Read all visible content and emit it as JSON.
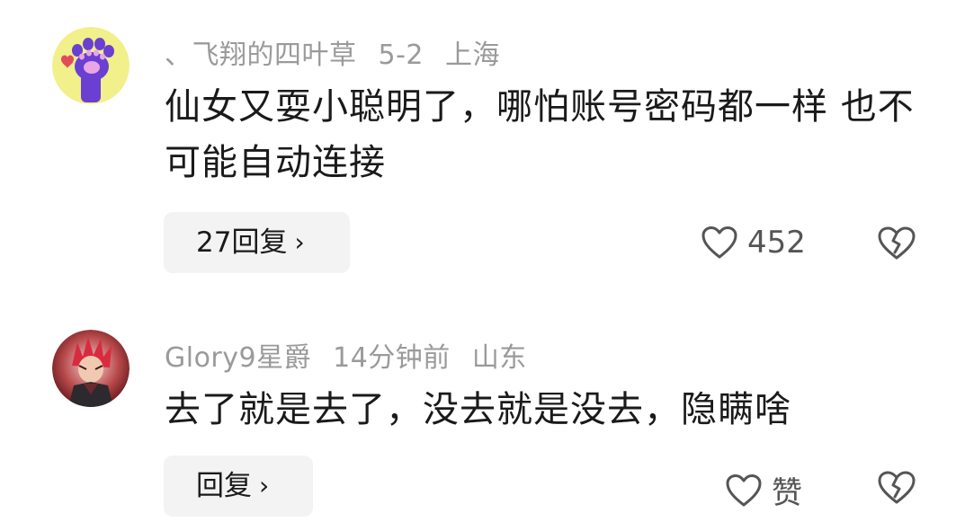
{
  "comments": [
    {
      "username": "、飞翔的四叶草",
      "date": "5-2",
      "location": "上海",
      "text": "仙女又耍小聪明了，哪怕账号密码都一样 也不可能自动连接",
      "reply_label": "27回复",
      "like_count": "452",
      "avatar_icon": "paw-icon"
    },
    {
      "username": "Glory9星爵",
      "date": "14分钟前",
      "location": "山东",
      "text": "去了就是去了，没去就是没去，隐瞒啥",
      "reply_label": "回复",
      "like_count": "赞",
      "avatar_icon": "character-avatar"
    }
  ],
  "icons": {
    "reply_chevron": "chevron-right-icon",
    "like": "heart-outline-icon",
    "dislike": "broken-heart-icon"
  },
  "colors": {
    "meta_text": "#9a9a9a",
    "body_text": "#1a1a1a",
    "reply_bg": "#f3f3f3",
    "icon": "#555555"
  }
}
